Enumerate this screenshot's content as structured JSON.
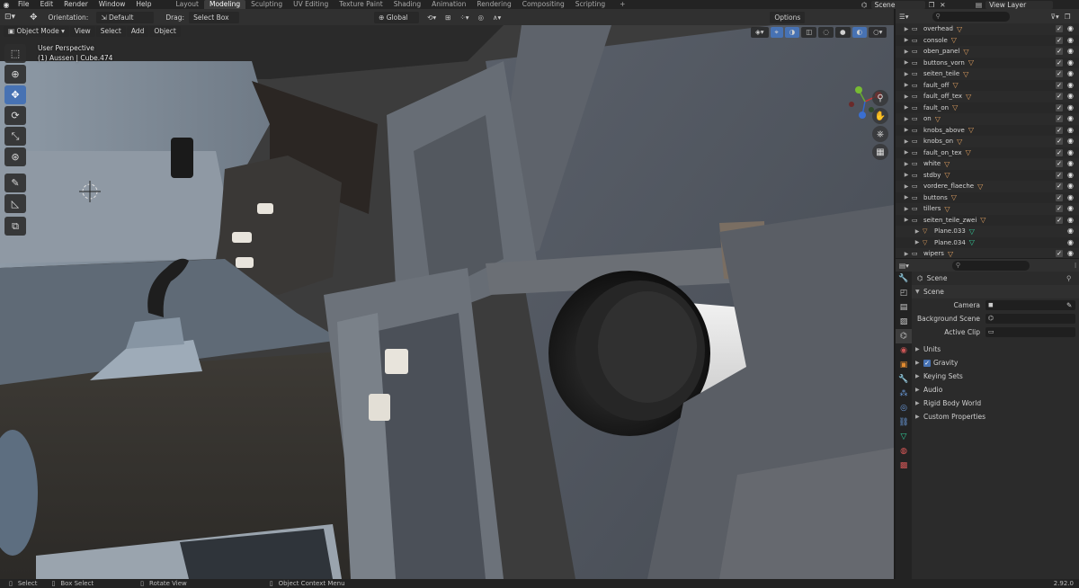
{
  "topbar": {
    "menus": [
      "File",
      "Edit",
      "Render",
      "Window",
      "Help"
    ],
    "workspaces": [
      "Layout",
      "Modeling",
      "Sculpting",
      "UV Editing",
      "Texture Paint",
      "Shading",
      "Animation",
      "Rendering",
      "Compositing",
      "Scripting"
    ],
    "active_workspace": "Modeling",
    "add_workspace": "+",
    "scene_name": "Scene",
    "view_layer": "View Layer"
  },
  "viewport_header": {
    "orientation_label": "Orientation:",
    "orientation_value": "Default",
    "drag_label": "Drag:",
    "drag_value": "Select Box",
    "transform_orientation": "Global",
    "options": "Options",
    "mode": "Object Mode",
    "menus": [
      "View",
      "Select",
      "Add",
      "Object"
    ]
  },
  "viewport": {
    "perspective": "User Perspective",
    "context": "(1) Aussen | Cube.474"
  },
  "outliner": {
    "rows": [
      {
        "label": "overhead",
        "child": false
      },
      {
        "label": "console",
        "child": false
      },
      {
        "label": "oben_panel",
        "child": false
      },
      {
        "label": "buttons_vorn",
        "child": false
      },
      {
        "label": "seiten_teile",
        "child": false
      },
      {
        "label": "fault_off",
        "child": false
      },
      {
        "label": "fault_off_tex",
        "child": false
      },
      {
        "label": "fault_on",
        "child": false
      },
      {
        "label": "on",
        "child": false
      },
      {
        "label": "knobs_above",
        "child": false
      },
      {
        "label": "knobs_on",
        "child": false
      },
      {
        "label": "fault_on_tex",
        "child": false
      },
      {
        "label": "white",
        "child": false
      },
      {
        "label": "stdby",
        "child": false
      },
      {
        "label": "vordere_flaeche",
        "child": false
      },
      {
        "label": "buttons",
        "child": false
      },
      {
        "label": "tillers",
        "child": false
      },
      {
        "label": "seiten_teile_zwei",
        "child": false
      },
      {
        "label": "Plane.033",
        "child": true
      },
      {
        "label": "Plane.034",
        "child": true
      },
      {
        "label": "wipers",
        "child": false
      }
    ]
  },
  "properties": {
    "header": "Scene",
    "section": "Scene",
    "fields": [
      {
        "label": "Camera"
      },
      {
        "label": "Background Scene"
      },
      {
        "label": "Active Clip"
      }
    ],
    "panels": [
      "Units",
      "Gravity",
      "Keying Sets",
      "Audio",
      "Rigid Body World",
      "Custom Properties"
    ]
  },
  "statusbar": {
    "select": "Select",
    "box_select": "Box Select",
    "rotate_view": "Rotate View",
    "context_menu": "Object Context Menu",
    "version": "2.92.0"
  },
  "colors": {
    "accent": "#4772b3",
    "outliner_triangle": "#e0a060",
    "background": "#1d1d1d"
  }
}
